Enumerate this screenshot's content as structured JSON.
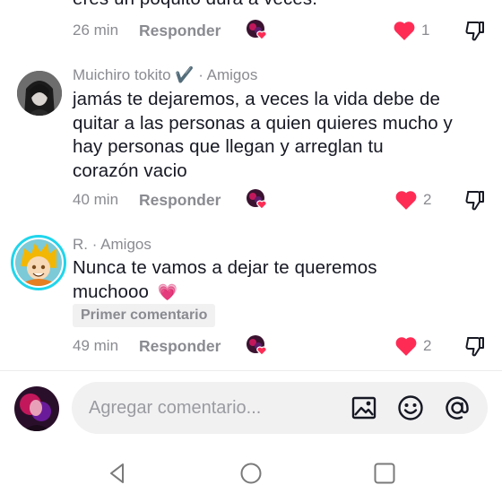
{
  "comments": [
    {
      "text": "eres un poquito dura a veces.",
      "time": "26 min",
      "reply_label": "Responder",
      "likes": "1"
    },
    {
      "author": "Muichiro tokito ✔️ · Amigos",
      "text_lines": [
        "jamás te dejaremos, a veces la vida debe de",
        "quitar a las personas a quien quieres mucho y",
        "hay personas que llegan y arreglan tu",
        "corazón vacio"
      ],
      "time": "40 min",
      "reply_label": "Responder",
      "likes": "2"
    },
    {
      "author": "R. · Amigos",
      "text_lines": [
        "Nunca te vamos a dejar te queremos",
        "muchooo"
      ],
      "emoji": "💗",
      "badge": "Primer comentario",
      "time": "49 min",
      "reply_label": "Responder",
      "likes": "2"
    }
  ],
  "composer": {
    "placeholder": "Agregar comentario..."
  },
  "icons": {
    "like": "heart-icon",
    "dislike": "thumbs-down-icon",
    "creator_like": "creator-liked-icon",
    "image": "image-icon",
    "emoji": "emoji-icon",
    "mention": "at-icon",
    "back": "back-icon",
    "home": "home-icon",
    "recents": "recents-icon"
  },
  "colors": {
    "like": "#fe2c55",
    "secondary_text": "#8a8b91",
    "primary_text": "#161823",
    "input_bg": "#f1f1f2",
    "avatar_ring": "#20d5ec"
  }
}
